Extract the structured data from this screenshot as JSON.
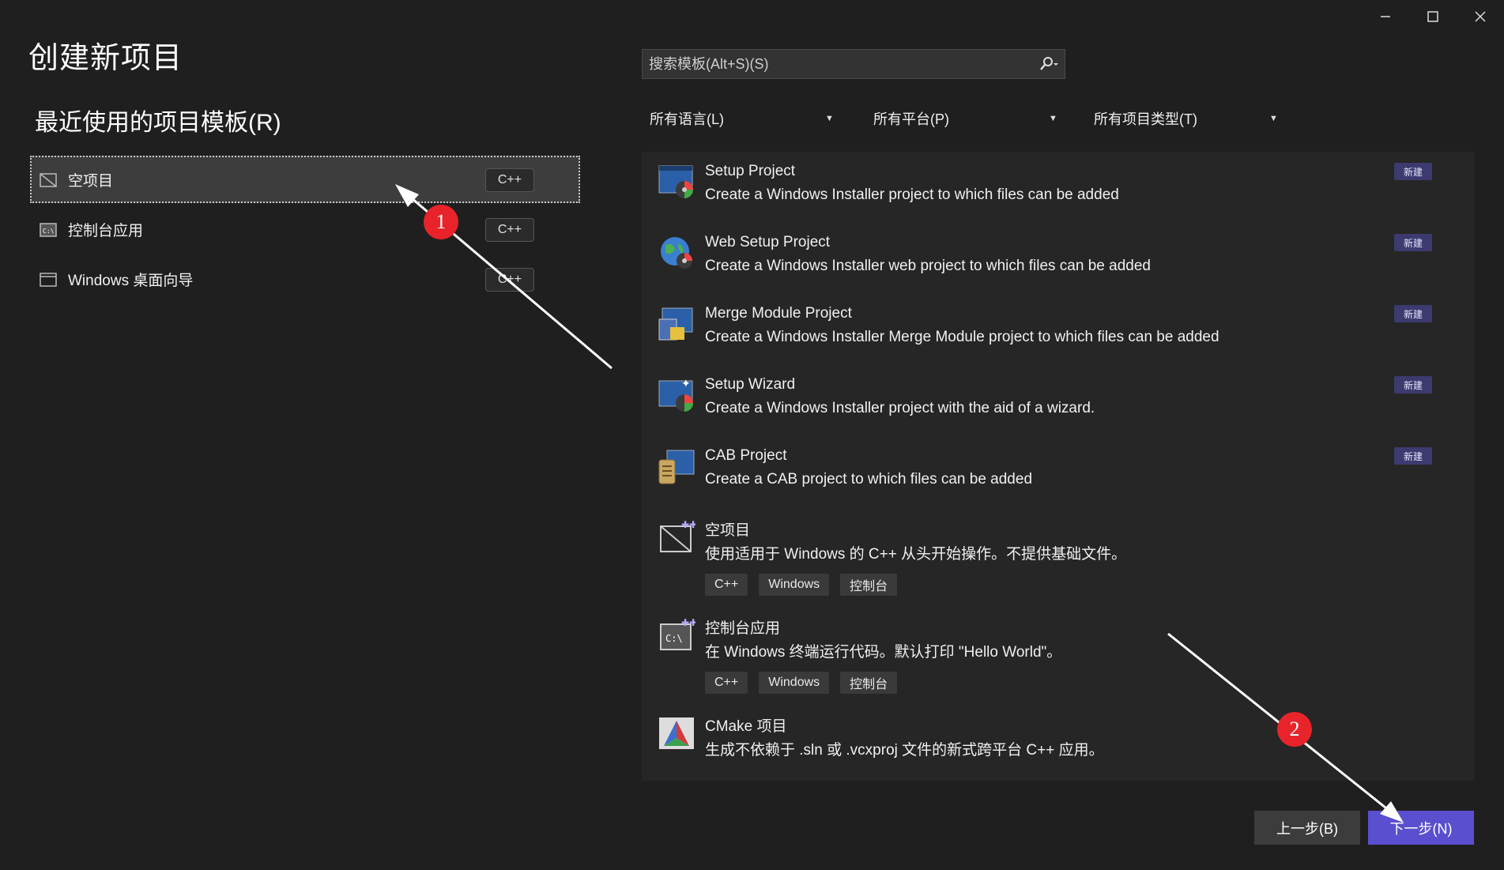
{
  "window": {
    "minimize_icon": "minimize-icon",
    "maximize_icon": "maximize-icon",
    "close_icon": "close-icon"
  },
  "page_title": "创建新项目",
  "recent": {
    "title": "最近使用的项目模板(R)",
    "items": [
      {
        "label": "空项目",
        "tag": "C++",
        "icon": "empty-project-icon"
      },
      {
        "label": "控制台应用",
        "tag": "C++",
        "icon": "console-app-icon"
      },
      {
        "label": "Windows 桌面向导",
        "tag": "C++",
        "icon": "desktop-wizard-icon"
      }
    ]
  },
  "search": {
    "placeholder": "搜索模板(Alt+S)(S)",
    "icon": "search-icon"
  },
  "filters": {
    "language": "所有语言(L)",
    "platform": "所有平台(P)",
    "project_type": "所有项目类型(T)"
  },
  "results": [
    {
      "title": "Setup Project",
      "desc": "Create a Windows Installer project to which files can be added",
      "badge": "新建",
      "icon": "setup-project-icon"
    },
    {
      "title": "Web Setup Project",
      "desc": "Create a Windows Installer web project to which files can be added",
      "badge": "新建",
      "icon": "web-setup-icon"
    },
    {
      "title": "Merge Module Project",
      "desc": "Create a Windows Installer Merge Module project to which files can be added",
      "badge": "新建",
      "icon": "merge-module-icon"
    },
    {
      "title": "Setup Wizard",
      "desc": "Create a Windows Installer project with the aid of a wizard.",
      "badge": "新建",
      "icon": "setup-wizard-icon"
    },
    {
      "title": "CAB Project",
      "desc": "Create a CAB project to which files can be added",
      "badge": "新建",
      "icon": "cab-project-icon"
    },
    {
      "title": "空项目",
      "desc": "使用适用于 Windows 的 C++ 从头开始操作。不提供基础文件。",
      "tags": [
        "C++",
        "Windows",
        "控制台"
      ],
      "icon": "empty-project-icon"
    },
    {
      "title": "控制台应用",
      "desc": "在 Windows 终端运行代码。默认打印 \"Hello World\"。",
      "tags": [
        "C++",
        "Windows",
        "控制台"
      ],
      "icon": "console-app-icon"
    },
    {
      "title": "CMake 项目",
      "desc": "生成不依赖于 .sln 或 .vcxproj 文件的新式跨平台 C++ 应用。",
      "icon": "cmake-icon"
    }
  ],
  "buttons": {
    "back": "上一步(B)",
    "next": "下一步(N)"
  },
  "annotations": {
    "marker1": "1",
    "marker2": "2",
    "color": "#e8242a"
  }
}
